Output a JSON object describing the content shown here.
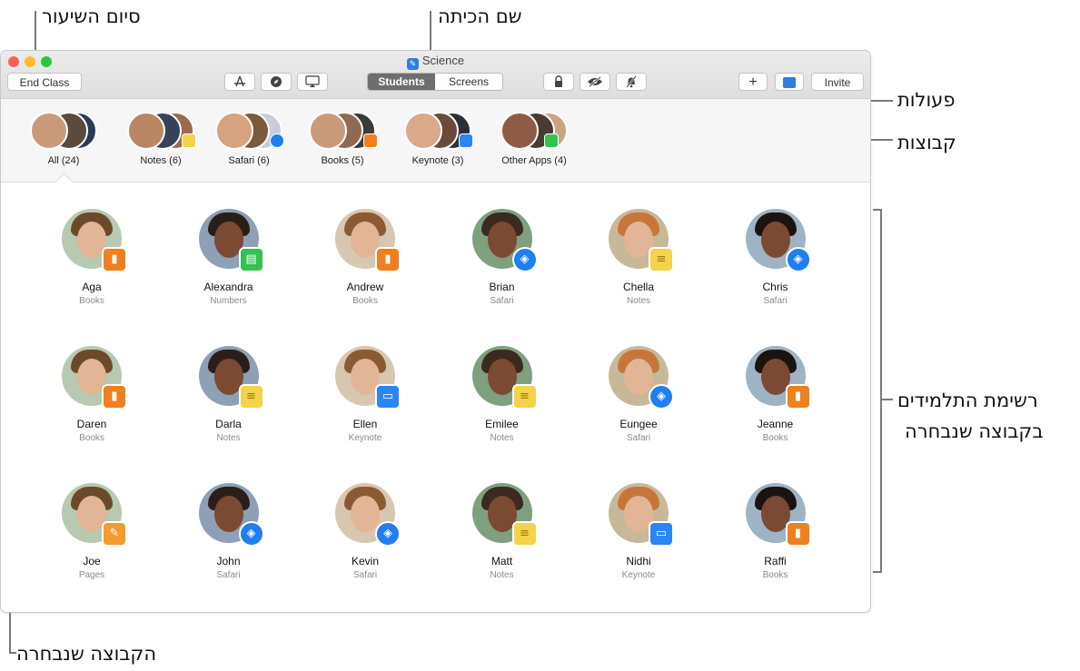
{
  "callouts": {
    "end_class": "סיום השיעור",
    "class_name": "שם הכיתה",
    "actions": "פעולות",
    "groups": "קבוצות",
    "student_list_line1": "רשימת התלמידים",
    "student_list_line2": "בקבוצה שנבחרה",
    "selected_group": "הקבוצה שנבחרה"
  },
  "window": {
    "title": "Science"
  },
  "toolbar": {
    "end_class_label": "End Class",
    "tabs": [
      "Students",
      "Screens"
    ],
    "invite_label": "Invite",
    "add_label": "+"
  },
  "groups": [
    {
      "label": "All (24)"
    },
    {
      "label": "Notes (6)"
    },
    {
      "label": "Safari (6)"
    },
    {
      "label": "Books (5)"
    },
    {
      "label": "Keynote (3)"
    },
    {
      "label": "Other Apps (4)"
    }
  ],
  "students": [
    {
      "name": "Aga",
      "app": "Books"
    },
    {
      "name": "Alexandra",
      "app": "Numbers"
    },
    {
      "name": "Andrew",
      "app": "Books"
    },
    {
      "name": "Brian",
      "app": "Safari"
    },
    {
      "name": "Chella",
      "app": "Notes"
    },
    {
      "name": "Chris",
      "app": "Safari"
    },
    {
      "name": "Daren",
      "app": "Books"
    },
    {
      "name": "Darla",
      "app": "Notes"
    },
    {
      "name": "Ellen",
      "app": "Keynote"
    },
    {
      "name": "Emilee",
      "app": "Notes"
    },
    {
      "name": "Eungee",
      "app": "Safari"
    },
    {
      "name": "Jeanne",
      "app": "Books"
    },
    {
      "name": "Joe",
      "app": "Pages"
    },
    {
      "name": "John",
      "app": "Safari"
    },
    {
      "name": "Kevin",
      "app": "Safari"
    },
    {
      "name": "Matt",
      "app": "Notes"
    },
    {
      "name": "Nidhi",
      "app": "Keynote"
    },
    {
      "name": "Raffi",
      "app": "Books"
    }
  ],
  "app_colors": {
    "Books": "#f07f1d",
    "Numbers": "#33c24d",
    "Safari": "#1f7ff0",
    "Notes": "#f4d24a",
    "Keynote": "#2a86f2",
    "Pages": "#f59a2e"
  },
  "icons": {
    "Books": "book-icon",
    "Numbers": "chart-icon",
    "Safari": "compass-icon",
    "Notes": "notepad-icon",
    "Keynote": "presentation-icon",
    "Pages": "pencil-icon"
  }
}
